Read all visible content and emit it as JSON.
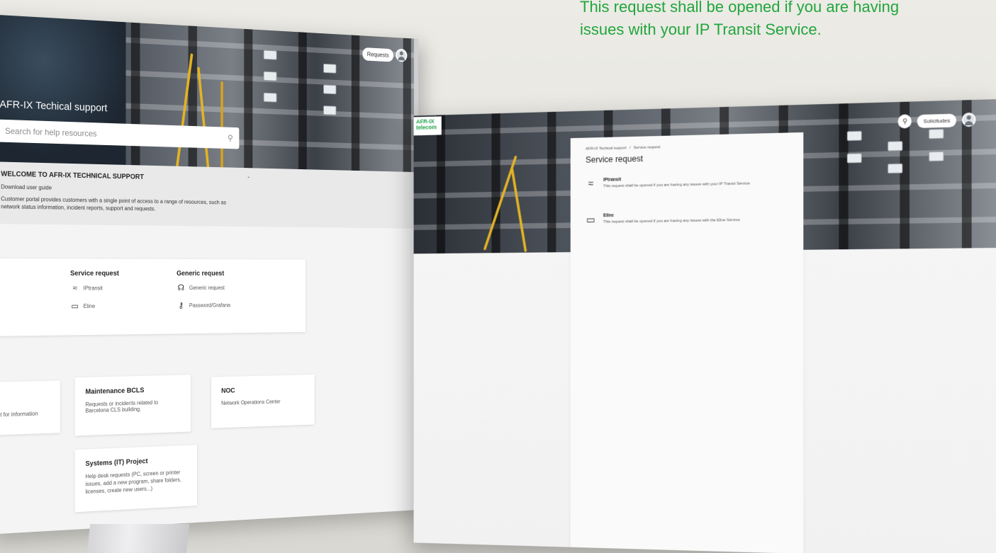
{
  "caption": {
    "line1": "This request shall be opened if you are having",
    "line2": "issues with your IP Transit Service."
  },
  "back_screen": {
    "title": "AFR-IX Techical support",
    "search_placeholder": "Search for help resources",
    "requests_label": "Requests",
    "welcome": {
      "heading": "WELCOME TO AFR-IX TECHNICAL SUPPORT",
      "link": "Download user guide",
      "text": "Customer portal provides customers with a single point of access to a range of resources, such as network status information, incident reports, support and requests."
    },
    "service_request": {
      "title": "Service request",
      "items": [
        {
          "label": "IPtransit",
          "icon": "wifi-icon"
        },
        {
          "label": "Eline",
          "icon": "laptop-icon"
        }
      ]
    },
    "generic_request": {
      "title": "Generic request",
      "items": [
        {
          "label": "Generic request",
          "icon": "headset-icon"
        },
        {
          "label": "Password/Grafana",
          "icon": "key-icon"
        }
      ]
    },
    "incident_fragment": "ident for information",
    "maintenance": {
      "title": "Maintenance BCLS",
      "text": "Requests or incidents related to Barcelona CLS building."
    },
    "noc": {
      "title": "NOC",
      "text": "Network Operations Center"
    },
    "systems": {
      "title": "Systems (IT) Project",
      "text": "Help desk requests (PC, screen or printer issues, add a new program, share folders, licenses, create new users...)"
    }
  },
  "front_screen": {
    "logo": {
      "line1": "AFR-IX",
      "line2": "telecom"
    },
    "requests_label": "Solicitudes",
    "breadcrumb": {
      "root": "AFR-IX Techical support",
      "separator": "/",
      "current": "Service request"
    },
    "title": "Service request",
    "services": [
      {
        "name": "IPtransit",
        "desc": "This request shall be opened if you are having any issues with your IP Transit Service.",
        "icon": "wifi-icon"
      },
      {
        "name": "Eline",
        "desc": "This request shall be opened if you are having any issues with the Eline Service.",
        "icon": "laptop-icon"
      }
    ]
  }
}
